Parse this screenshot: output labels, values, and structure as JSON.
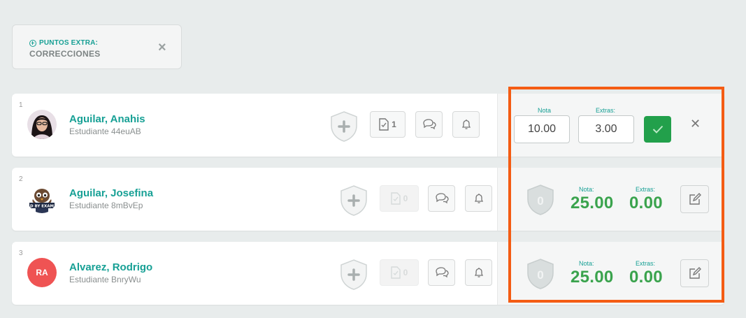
{
  "filter": {
    "label": "PUNTOS EXTRA:",
    "value": "CORRECCIONES",
    "close": "×"
  },
  "students": [
    {
      "index": "1",
      "name": "Aguilar, Anahis",
      "subtitle": "Estudiante 44euAB",
      "doc_count": "1",
      "edit": {
        "nota_label": "Nota",
        "extras_label": "Extras:",
        "nota_value": "10.00",
        "extras_value": "3.00"
      }
    },
    {
      "index": "2",
      "name": "Aguilar, Josefina",
      "subtitle": "Estudiante 8mBvEp",
      "doc_count": "0",
      "grade": {
        "shield_value": "0",
        "nota_label": "Nota:",
        "nota_value": "25.00",
        "extras_label": "Extras:",
        "extras_value": "0.00"
      }
    },
    {
      "index": "3",
      "name": "Alvarez, Rodrigo",
      "subtitle": "Estudiante BnryWu",
      "initials": "RA",
      "doc_count": "0",
      "grade": {
        "shield_value": "0",
        "nota_label": "Nota:",
        "nota_value": "25.00",
        "extras_label": "Extras:",
        "extras_value": "0.00"
      }
    }
  ],
  "colors": {
    "accent": "#17a095",
    "grade_value": "#3aa34d",
    "confirm": "#22a04b",
    "initials_avatar": "#ef5353",
    "highlight": "#f45c13"
  },
  "icons": [
    "add-circle-icon",
    "close-icon",
    "shield-plus-icon",
    "doc-check-icon",
    "chat-icon",
    "bell-icon",
    "check-icon",
    "edit-icon",
    "shield-icon"
  ]
}
